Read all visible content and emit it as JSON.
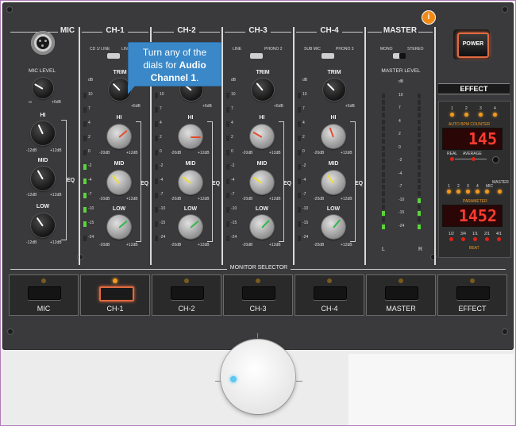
{
  "mic": {
    "title": "MIC",
    "level_label": "MIC LEVEL",
    "hi": "HI",
    "mid": "MID",
    "low": "LOW",
    "eq": "EQ",
    "db_lo": "-12dB",
    "db_hi": "+12dB",
    "lvl_min": "-∞",
    "lvl_max": "+6dB"
  },
  "channels": [
    {
      "title": "CH-1",
      "in_left": "CD 1/ LINE",
      "in_right": "LINE"
    },
    {
      "title": "CH-2",
      "in_left": "",
      "in_right": ""
    },
    {
      "title": "CH-3",
      "in_left": "LINE",
      "in_right": "PHONO 2"
    },
    {
      "title": "CH-4",
      "in_left": "SUB MIC",
      "in_right": "PHONO 3"
    }
  ],
  "channel_labels": {
    "trim": "TRIM",
    "hi": "HI",
    "mid": "MID",
    "low": "LOW",
    "eq": "EQ",
    "db_lo": "-20dB",
    "db_hi": "+12dB",
    "trim_max": "+6dB"
  },
  "meter_scale": [
    "dB",
    "10",
    "7",
    "4",
    "2",
    "0",
    "-2",
    "-4",
    "-7",
    "-10",
    "-15",
    "-24"
  ],
  "master": {
    "title": "MASTER",
    "mono": "MONO",
    "stereo": "STEREO",
    "level": "MASTER LEVEL",
    "scale": [
      "dB",
      "10",
      "7",
      "4",
      "2",
      "0",
      "-2",
      "-4",
      "-7",
      "-10",
      "-15",
      "-24"
    ],
    "left": "L",
    "right": "R"
  },
  "tooltip": {
    "line1": "Turn any of the",
    "line2": "dials for ",
    "bold": "Audio Channel 1",
    "end": "."
  },
  "power": {
    "label": "POWER"
  },
  "effect": {
    "title": "EFFECT",
    "nums": [
      "1",
      "2",
      "3",
      "4"
    ],
    "bpm_label": "AUTO BPM COUNTER",
    "bpm_value": "145",
    "real": "REAL",
    "average": "AVERAGE",
    "param_nums": [
      "1",
      "2",
      "3",
      "4",
      "MIC"
    ],
    "master_label": "MASTER",
    "parameter_label": "PARAMETER",
    "param_value": "1452",
    "beats": [
      "1/2",
      "3/4",
      "1/1",
      "2/1",
      "4/1"
    ],
    "beat_label": "BEAT"
  },
  "monitor": {
    "title": "MONITOR SELECTOR",
    "buttons": [
      "MIC",
      "CH-1",
      "CH-2",
      "CH-3",
      "CH-4",
      "MASTER",
      "EFFECT"
    ]
  },
  "info": {
    "glyph": "i"
  }
}
